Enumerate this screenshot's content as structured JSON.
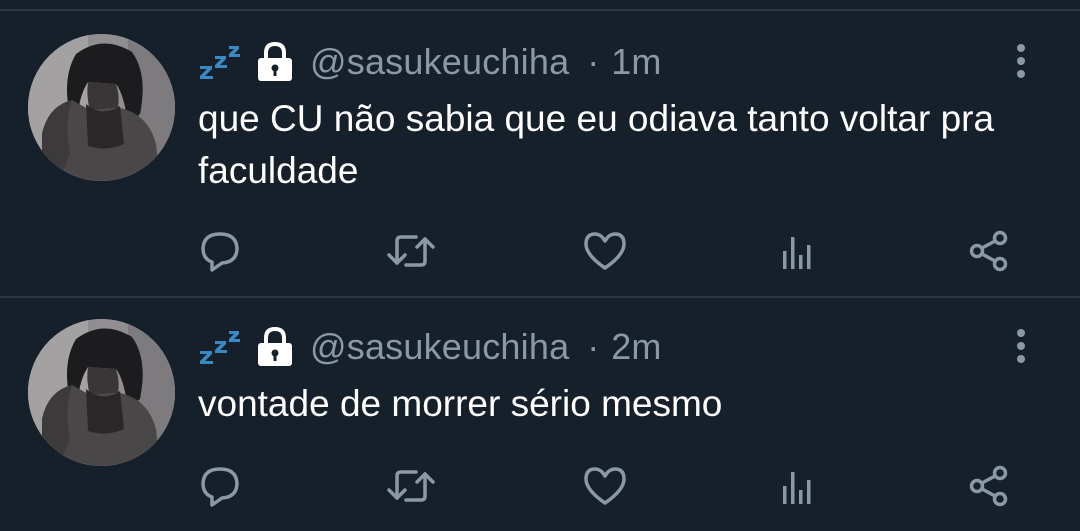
{
  "colors": {
    "background": "#15202b",
    "divider": "#2a3642",
    "secondary_text": "#8b98a5",
    "primary_text": "#ffffff",
    "zzz_blue": "#3b88c3"
  },
  "tweets": [
    {
      "handle": "@sasukeuchiha",
      "separator": "·",
      "time": "1m",
      "text": "que CU não sabia que eu odiava tanto voltar pra faculdade",
      "icons": [
        "zzz-emoji-icon",
        "lock-emoji-icon",
        "more-options-icon",
        "reply-icon",
        "retweet-icon",
        "like-icon",
        "views-icon",
        "share-icon"
      ]
    },
    {
      "handle": "@sasukeuchiha",
      "separator": "·",
      "time": "2m",
      "text": "vontade de morrer sério mesmo",
      "icons": [
        "zzz-emoji-icon",
        "lock-emoji-icon",
        "more-options-icon",
        "reply-icon",
        "retweet-icon",
        "like-icon",
        "views-icon",
        "share-icon"
      ]
    }
  ]
}
